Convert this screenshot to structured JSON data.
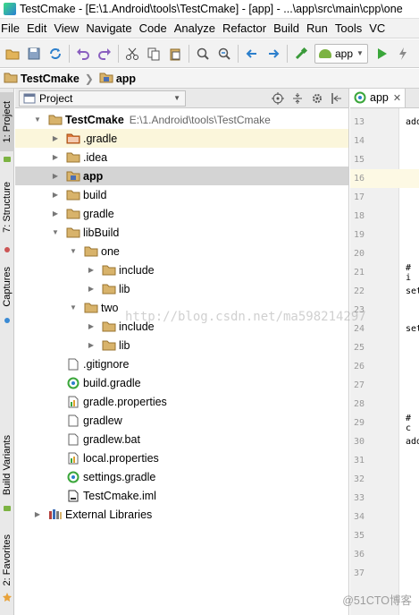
{
  "window": {
    "title": "TestCmake - [E:\\1.Android\\tools\\TestCmake] - [app] - ...\\app\\src\\main\\cpp\\one"
  },
  "menubar": [
    "File",
    "Edit",
    "View",
    "Navigate",
    "Code",
    "Analyze",
    "Refactor",
    "Build",
    "Run",
    "Tools",
    "VC"
  ],
  "toolbar": {
    "run_config": "app"
  },
  "navbar": {
    "crumbs": [
      "TestCmake",
      "app"
    ]
  },
  "left_strip": {
    "tabs": [
      "1: Project",
      "7: Structure",
      "Captures",
      "Build Variants",
      "2: Favorites"
    ]
  },
  "project_panel": {
    "view": "Project",
    "tree": [
      {
        "label": "TestCmake",
        "path": "E:\\1.Android\\tools\\TestCmake",
        "icon": "folder",
        "indent": 0,
        "arrow": "open",
        "bold": true
      },
      {
        "label": ".gradle",
        "icon": "folder-orange",
        "indent": 1,
        "arrow": "closed",
        "state": "hl"
      },
      {
        "label": ".idea",
        "icon": "folder",
        "indent": 1,
        "arrow": "closed"
      },
      {
        "label": "app",
        "icon": "module-folder",
        "indent": 1,
        "arrow": "closed",
        "bold": true,
        "state": "selected"
      },
      {
        "label": "build",
        "icon": "folder",
        "indent": 1,
        "arrow": "closed"
      },
      {
        "label": "gradle",
        "icon": "folder",
        "indent": 1,
        "arrow": "closed"
      },
      {
        "label": "libBuild",
        "icon": "folder",
        "indent": 1,
        "arrow": "open"
      },
      {
        "label": "one",
        "icon": "folder",
        "indent": 2,
        "arrow": "open"
      },
      {
        "label": "include",
        "icon": "folder",
        "indent": 3,
        "arrow": "closed"
      },
      {
        "label": "lib",
        "icon": "folder",
        "indent": 3,
        "arrow": "closed"
      },
      {
        "label": "two",
        "icon": "folder",
        "indent": 2,
        "arrow": "open"
      },
      {
        "label": "include",
        "icon": "folder",
        "indent": 3,
        "arrow": "closed"
      },
      {
        "label": "lib",
        "icon": "folder",
        "indent": 3,
        "arrow": "closed"
      },
      {
        "label": ".gitignore",
        "icon": "text-file",
        "indent": 1,
        "arrow": "none"
      },
      {
        "label": "build.gradle",
        "icon": "gradle-file",
        "indent": 1,
        "arrow": "none"
      },
      {
        "label": "gradle.properties",
        "icon": "properties-file",
        "indent": 1,
        "arrow": "none"
      },
      {
        "label": "gradlew",
        "icon": "text-file",
        "indent": 1,
        "arrow": "none"
      },
      {
        "label": "gradlew.bat",
        "icon": "text-file",
        "indent": 1,
        "arrow": "none"
      },
      {
        "label": "local.properties",
        "icon": "properties-file",
        "indent": 1,
        "arrow": "none"
      },
      {
        "label": "settings.gradle",
        "icon": "gradle-file",
        "indent": 1,
        "arrow": "none"
      },
      {
        "label": "TestCmake.iml",
        "icon": "iml-file",
        "indent": 1,
        "arrow": "none"
      },
      {
        "label": "External Libraries",
        "icon": "libraries",
        "indent": 0,
        "arrow": "closed"
      }
    ]
  },
  "editor": {
    "tab": "app",
    "lines": [
      {
        "no": "13",
        "code": "add"
      },
      {
        "no": "14",
        "code": ""
      },
      {
        "no": "15",
        "code": ""
      },
      {
        "no": "16",
        "code": "",
        "current": true
      },
      {
        "no": "17",
        "code": ""
      },
      {
        "no": "18",
        "code": ""
      },
      {
        "no": "19",
        "code": ""
      },
      {
        "no": "20",
        "code": ""
      },
      {
        "no": "21",
        "code": "# i"
      },
      {
        "no": "22",
        "code": "set"
      },
      {
        "no": "23",
        "code": ""
      },
      {
        "no": "24",
        "code": "set"
      },
      {
        "no": "25",
        "code": ""
      },
      {
        "no": "26",
        "code": ""
      },
      {
        "no": "27",
        "code": ""
      },
      {
        "no": "28",
        "code": ""
      },
      {
        "no": "29",
        "code": "# c"
      },
      {
        "no": "30",
        "code": "add"
      },
      {
        "no": "31",
        "code": ""
      },
      {
        "no": "32",
        "code": ""
      },
      {
        "no": "33",
        "code": ""
      },
      {
        "no": "34",
        "code": ""
      },
      {
        "no": "35",
        "code": ""
      },
      {
        "no": "36",
        "code": ""
      },
      {
        "no": "37",
        "code": ""
      }
    ]
  },
  "watermark": "http://blog.csdn.net/ma598214297",
  "watermark_corner": "@51CTO博客",
  "colors": {
    "folder": "#c9a25a",
    "accent_green": "#3aa63a",
    "selection": "#d4d4d4"
  }
}
